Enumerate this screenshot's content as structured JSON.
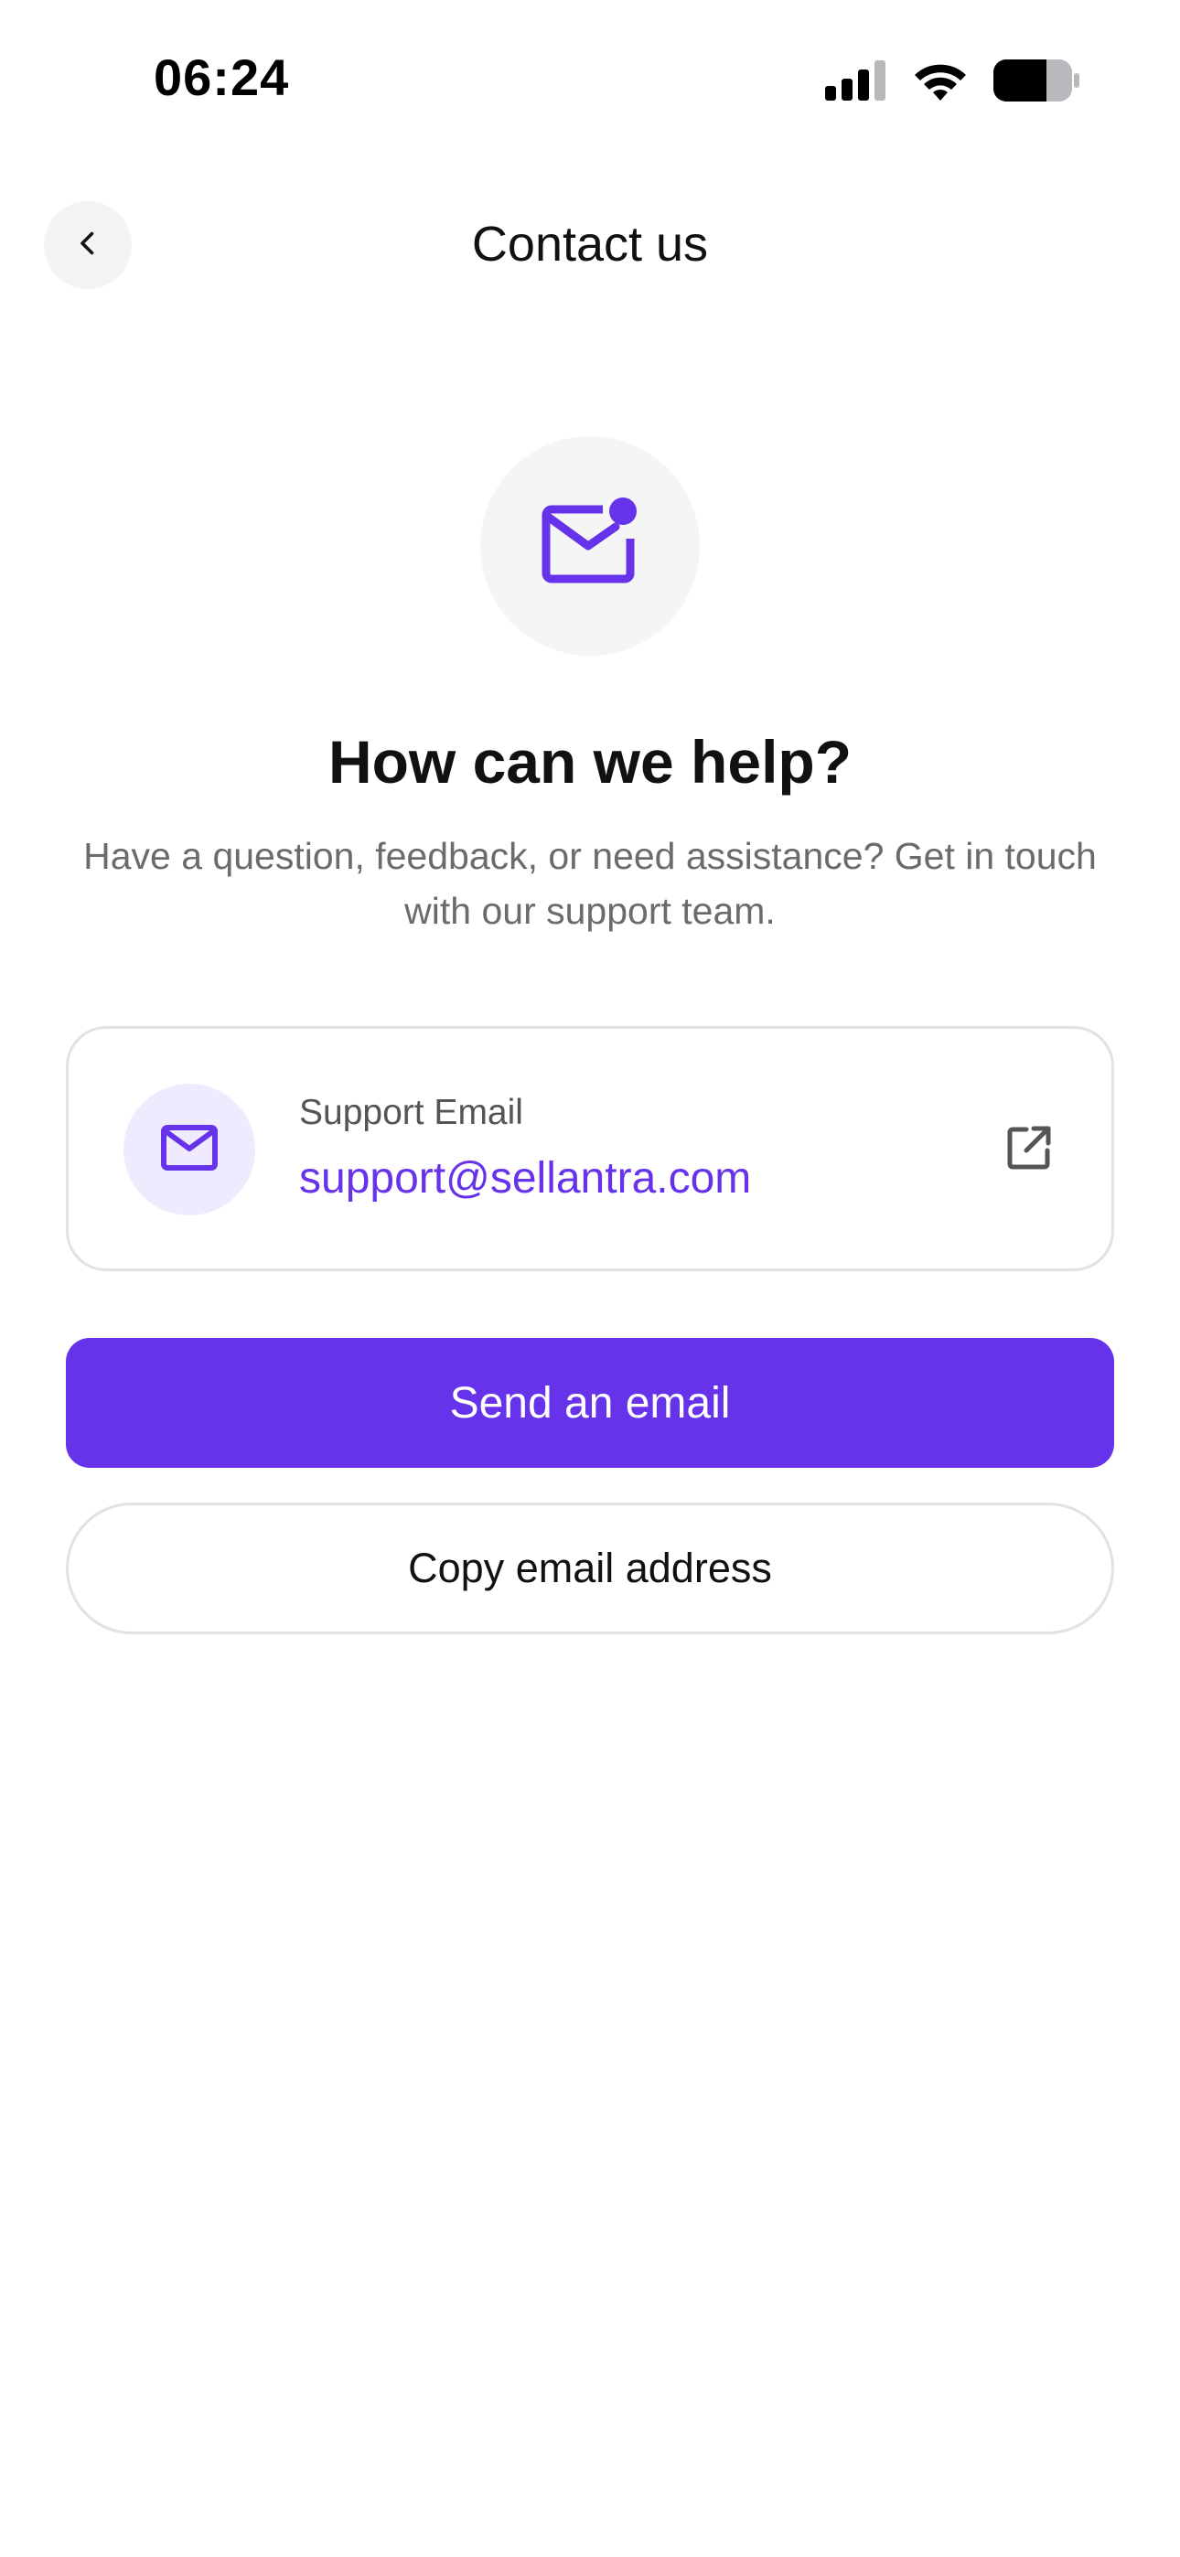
{
  "status_bar": {
    "time": "06:24",
    "icons": [
      "signal-icon",
      "wifi-icon",
      "battery-icon"
    ]
  },
  "header": {
    "title": "Contact us",
    "back_icon": "chevron-left-icon"
  },
  "hero": {
    "icon": "mail-notification-icon",
    "title": "How can we help?",
    "subtitle": "Have a question, feedback, or need assistance? Get in touch with our support team."
  },
  "email_card": {
    "icon": "mail-icon",
    "label": "Support Email",
    "email": "support@sellantra.com",
    "action_icon": "open-external-icon"
  },
  "actions": {
    "send_email_label": "Send an email",
    "copy_email_label": "Copy email address"
  },
  "colors": {
    "accent": "#6633ea",
    "accent_light": "#efeafd",
    "card_border": "#e2e2e4",
    "icon_bg": "#f5f5f6"
  }
}
